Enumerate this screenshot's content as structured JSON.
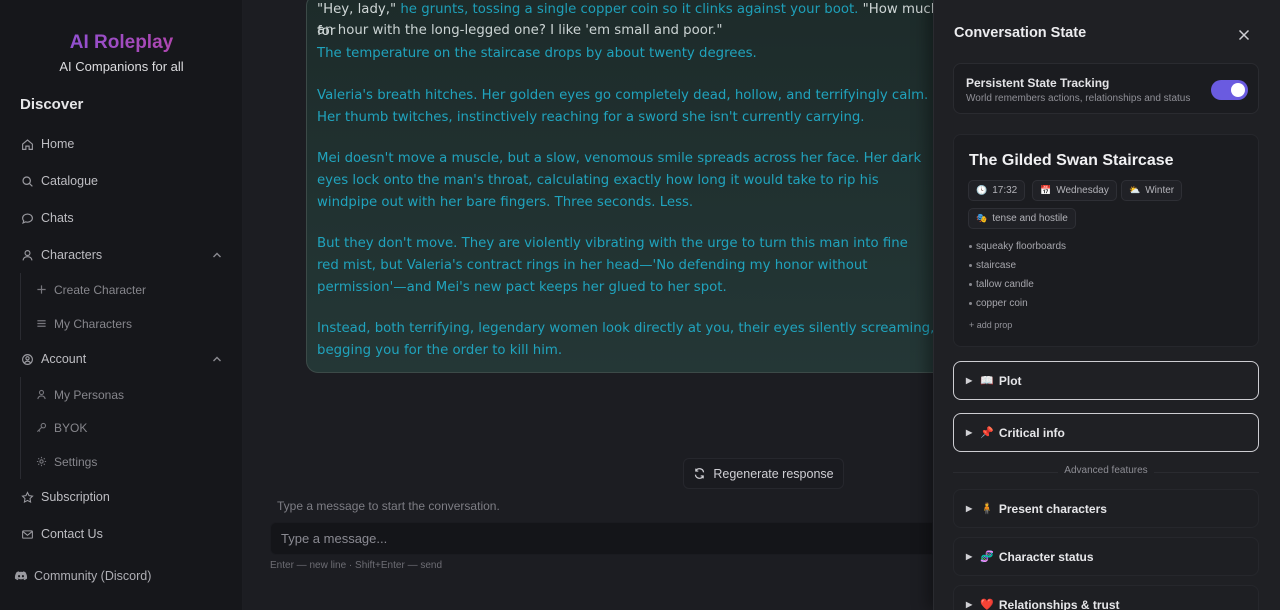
{
  "sidebar": {
    "brand": "AI Roleplay",
    "tagline": "AI Companions for all",
    "section_title": "Discover",
    "items": {
      "home": "Home",
      "catalogue": "Catalogue",
      "chats": "Chats",
      "characters": "Characters",
      "create_character": "Create Character",
      "my_characters": "My Characters",
      "account": "Account",
      "my_personas": "My Personas",
      "byok": "BYOK",
      "settings": "Settings",
      "subscription": "Subscription",
      "contact": "Contact Us",
      "community": "Community (Discord)"
    }
  },
  "chat": {
    "message": {
      "top_quote": "\"Hey, lady,\"",
      "top_action": "he grunts, tossing a single copper coin so it clinks against your boot.",
      "top_quote2": "\"How much for",
      "top_line2": "an hour with the long-legged one? I like 'em small and poor.\"",
      "p1": "The temperature on the staircase drops by about twenty degrees.",
      "p2a": "Valeria's breath hitches. Her golden eyes go completely dead, hollow, and terrifyingly calm.",
      "p2b": "Her thumb twitches, instinctively reaching for a sword she isn't currently carrying.",
      "p3a": "Mei doesn't move a muscle, but a slow, venomous smile spreads across her face. Her dark",
      "p3b": "eyes lock onto the man's throat, calculating exactly how long it would take to rip his",
      "p3c": "windpipe out with her bare fingers. Three seconds. Less.",
      "p4a": "But they don't move. They are violently vibrating with the urge to turn this man into fine",
      "p4b": "red mist, but Valeria's contract rings in her head—'No defending my honor without",
      "p4c": "permission'—and Mei's new pact keeps her glued to her spot.",
      "p5a": "Instead, both terrifying, legendary women look directly at you, their eyes silently screaming,",
      "p5b": "begging you for the order to kill him."
    },
    "regenerate_label": "Regenerate response",
    "empty_hint": "Type a message to start the conversation.",
    "input_placeholder": "Type a message...",
    "input_hint": "Enter — new line · Shift+Enter — send"
  },
  "panel": {
    "title": "Conversation State",
    "tracking": {
      "title": "Persistent State Tracking",
      "subtitle": "World remembers actions, relationships and status",
      "enabled": true
    },
    "scene": {
      "title": "The Gilded Swan Staircase",
      "time": "17:32",
      "day": "Wednesday",
      "season": "Winter",
      "mood": "tense and hostile",
      "props": [
        "squeaky floorboards",
        "staircase",
        "tallow candle",
        "copper coin"
      ],
      "add_prop": "+ add prop"
    },
    "sections": {
      "plot": "Plot",
      "critical": "Critical info",
      "advanced": "Advanced features",
      "present": "Present characters",
      "status": "Character status",
      "relationships": "Relationships & trust"
    }
  },
  "colors": {
    "accent": "#6a5be0",
    "narration": "#20a3bd",
    "brand_start": "#7e58e8",
    "brand_end": "#c23f98"
  }
}
